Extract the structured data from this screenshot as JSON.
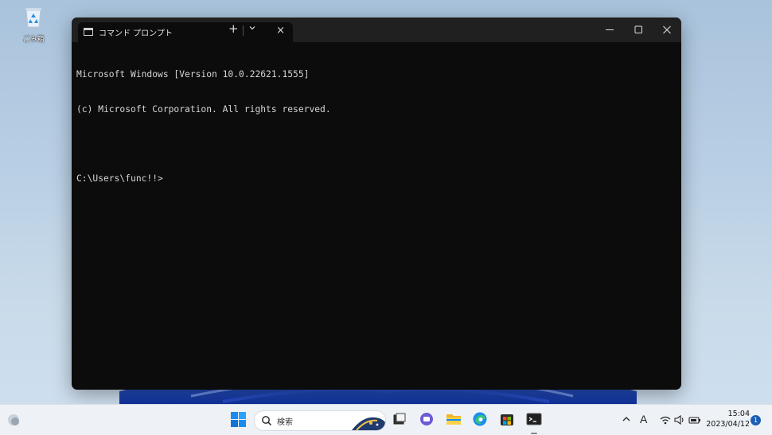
{
  "desktop": {
    "recycle_bin_label": "ごみ箱"
  },
  "window": {
    "tab_title": "コマンド プロンプト",
    "tab_close_glyph": "×",
    "new_tab_glyph": "+",
    "console_lines": [
      "Microsoft Windows [Version 10.0.22621.1555]",
      "(c) Microsoft Corporation. All rights reserved.",
      "",
      "C:\\Users\\func!!>"
    ]
  },
  "taskbar": {
    "search_placeholder": "検索",
    "ime_indicator": "A",
    "time": "15:04",
    "date": "2023/04/12",
    "notification_count": "1",
    "apps": [
      "task-view",
      "teams-chat",
      "file-explorer",
      "edge",
      "microsoft-store",
      "terminal"
    ]
  },
  "colors": {
    "accent": "#0078d4",
    "console_bg": "#0c0c0c",
    "titlebar_bg": "#202020",
    "console_text": "#d6d6d6"
  }
}
